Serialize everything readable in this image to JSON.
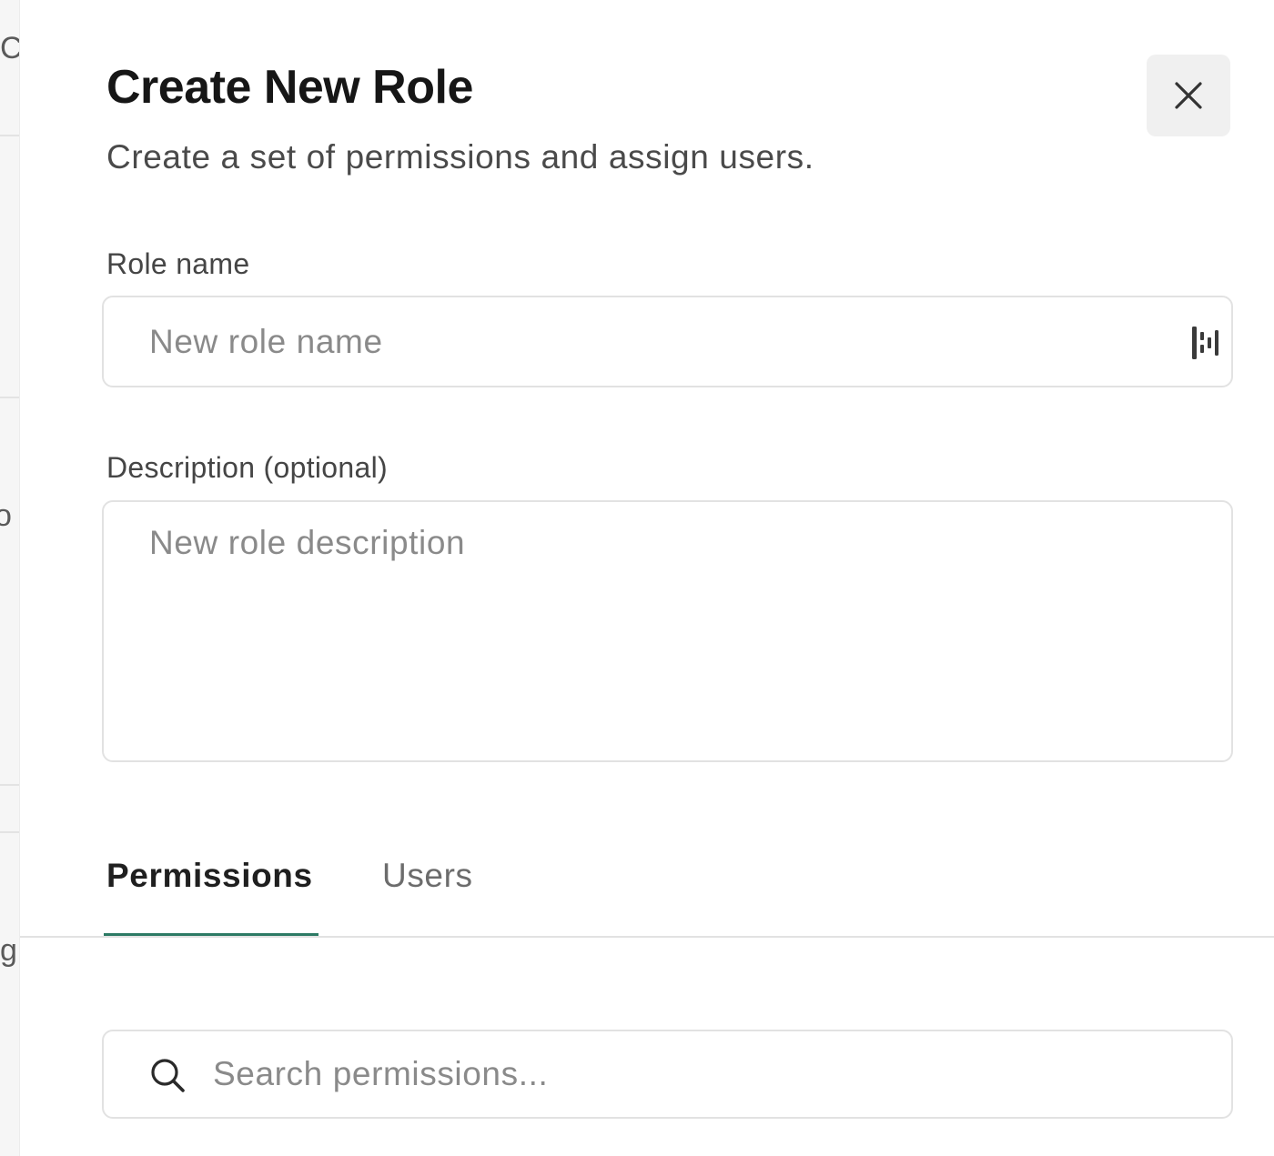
{
  "background_fragments": [
    "C",
    "o",
    "gi"
  ],
  "dialog": {
    "title": "Create New Role",
    "subtitle": "Create a set of permissions and assign users.",
    "close_icon": "close-icon"
  },
  "form": {
    "role_name": {
      "label": "Role name",
      "value": "",
      "placeholder": "New role name",
      "addon_icon": "password-manager-icon"
    },
    "description": {
      "label": "Description (optional)",
      "value": "",
      "placeholder": "New role description"
    }
  },
  "tabs": [
    {
      "label": "Permissions",
      "active": true
    },
    {
      "label": "Users",
      "active": false
    }
  ],
  "search": {
    "placeholder": "Search permissions...",
    "value": "",
    "icon": "search-icon"
  },
  "colors": {
    "accent": "#2c7a64",
    "close_button_bg": "#f0f0f0",
    "border": "#e2e2e2"
  }
}
